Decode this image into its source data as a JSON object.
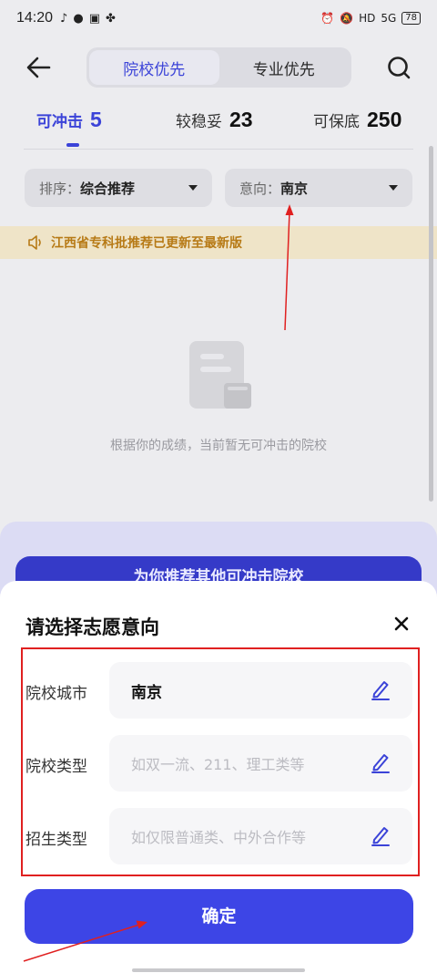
{
  "status_bar": {
    "time": "14:20",
    "battery": "78",
    "network": "5G"
  },
  "header": {
    "tabs": [
      {
        "label": "院校优先"
      },
      {
        "label": "专业优先"
      }
    ]
  },
  "categories": [
    {
      "label": "可冲击",
      "count": "5"
    },
    {
      "label": "较稳妥",
      "count": "23"
    },
    {
      "label": "可保底",
      "count": "250"
    }
  ],
  "filters": {
    "sort": {
      "label": "排序：",
      "value": "综合推荐"
    },
    "intent": {
      "label": "意向：",
      "value": "南京"
    }
  },
  "notice": {
    "text": "江西省专科批推荐已更新至最新版"
  },
  "empty_state": {
    "text": "根据你的成绩，当前暂无可冲击的院校"
  },
  "under_button": {
    "label": "为你推荐其他可冲击院校"
  },
  "sheet": {
    "title": "请选择志愿意向",
    "rows": [
      {
        "label": "院校城市",
        "value": "南京",
        "placeholder": ""
      },
      {
        "label": "院校类型",
        "value": "",
        "placeholder": "如双一流、211、理工类等"
      },
      {
        "label": "招生类型",
        "value": "",
        "placeholder": "如仅限普通类、中外合作等"
      }
    ],
    "confirm_label": "确定"
  },
  "colors": {
    "accent": "#3d45e6",
    "annotation": "#e02020",
    "notice": "#b77a16"
  }
}
